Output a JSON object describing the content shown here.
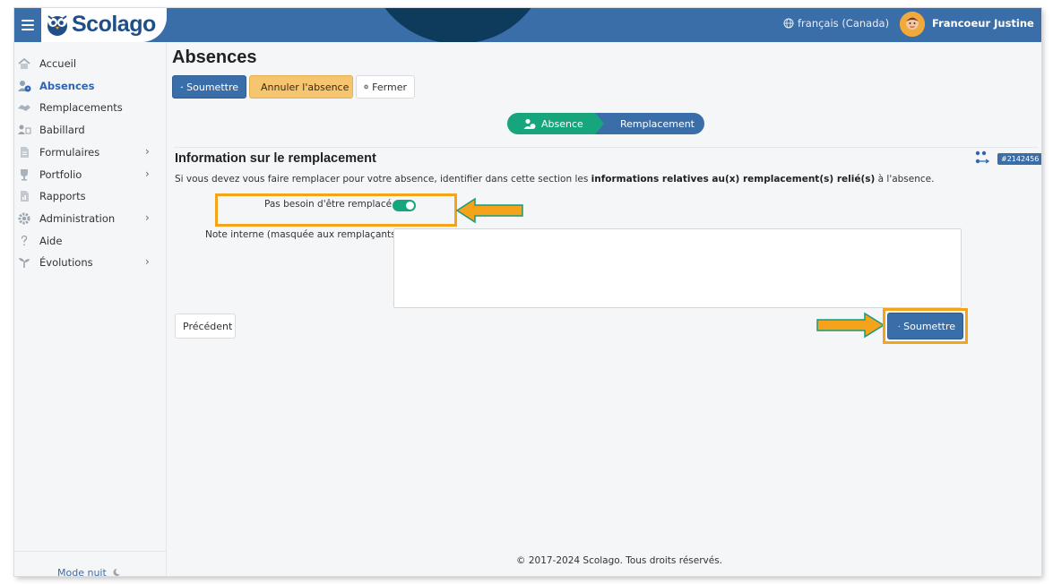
{
  "brand": {
    "name": "Scolago"
  },
  "header": {
    "language": "français (Canada)",
    "user_name": "Francoeur Justine"
  },
  "sidebar": {
    "items": [
      {
        "label": "Accueil",
        "icon": "home-icon",
        "active": false,
        "has_children": false
      },
      {
        "label": "Absences",
        "icon": "user-clock-icon",
        "active": true,
        "has_children": false
      },
      {
        "label": "Remplacements",
        "icon": "handshake-icon",
        "active": false,
        "has_children": false
      },
      {
        "label": "Babillard",
        "icon": "board-icon",
        "active": false,
        "has_children": false
      },
      {
        "label": "Formulaires",
        "icon": "document-icon",
        "active": false,
        "has_children": true
      },
      {
        "label": "Portfolio",
        "icon": "trophy-icon",
        "active": false,
        "has_children": true
      },
      {
        "label": "Rapports",
        "icon": "report-icon",
        "active": false,
        "has_children": false
      },
      {
        "label": "Administration",
        "icon": "gear-icon",
        "active": false,
        "has_children": true
      },
      {
        "label": "Aide",
        "icon": "question-icon",
        "active": false,
        "has_children": false
      },
      {
        "label": "Évolutions",
        "icon": "sprout-icon",
        "active": false,
        "has_children": true
      }
    ],
    "chevron": "›",
    "night_mode": "Mode nuit"
  },
  "page": {
    "title": "Absences",
    "toolbar": {
      "submit": "Soumettre",
      "cancel": "Annuler l'absence",
      "close": "Fermer"
    },
    "steps": [
      {
        "label": "Absence"
      },
      {
        "label": "Remplacement"
      }
    ],
    "section": {
      "title": "Information sur le remplacement",
      "id_badge": "#2142456",
      "info_prefix": "Si vous devez vous faire remplacer pour votre absence, identifier dans cette section les ",
      "info_bold": "informations relatives au(x) remplacement(s) relié(s)",
      "info_suffix": " à l'absence."
    },
    "toggle": {
      "label": "Pas besoin d'être remplacé",
      "on": true
    },
    "note": {
      "label": "Note interne (masquée aux remplaçants)",
      "value": ""
    },
    "previous": "Précédent",
    "submit_bottom": "Soumettre"
  },
  "footer": "© 2017-2024 Scolago. Tous droits réservés.",
  "colors": {
    "primary": "#3a6ea8",
    "success": "#17a57e",
    "warning": "#f6c56f",
    "highlight": "#f5a31a",
    "arrow_border": "#1a9a7a"
  }
}
